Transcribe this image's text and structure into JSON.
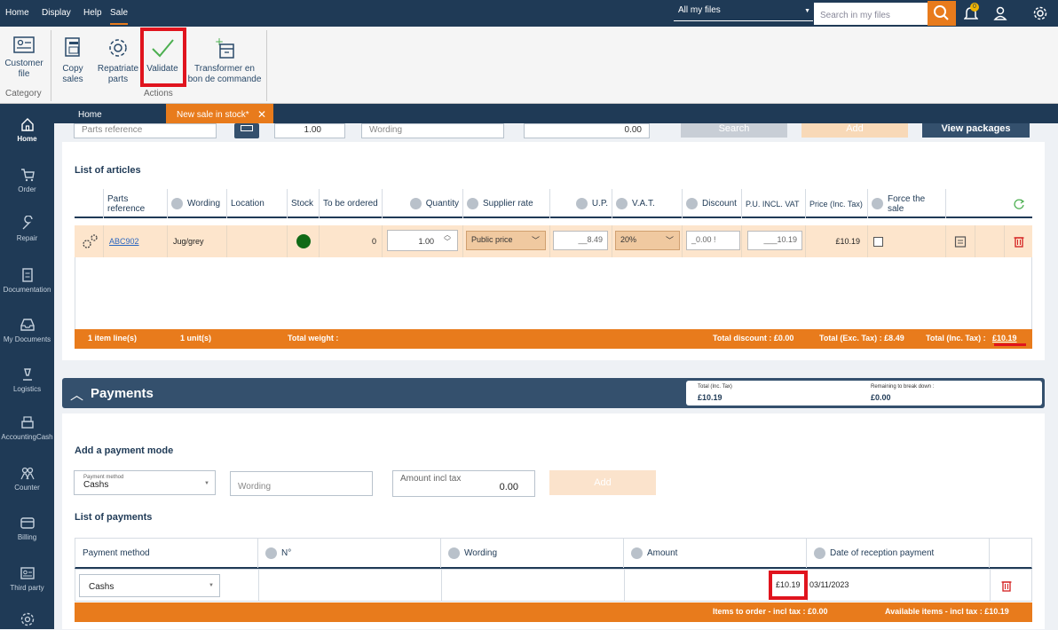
{
  "menu": {
    "home": "Home",
    "display": "Display",
    "help": "Help",
    "sale": "Sale"
  },
  "files_select": "All my files",
  "search": {
    "placeholder": "Search in my files",
    "notif_count": "0"
  },
  "ribbon": {
    "customer_file": "Customer file",
    "category": "Category",
    "copy_sales": "Copy sales",
    "repatriate_parts": "Repatriate parts",
    "validate": "Validate",
    "transform": "Transformer en bon de commande",
    "actions": "Actions"
  },
  "sidebar": [
    "Home",
    "Order",
    "Repair",
    "Documentation",
    "My Documents",
    "Logistics",
    "AccountingCash",
    "Counter",
    "Billing",
    "Third party"
  ],
  "tabs": {
    "home": "Home",
    "new_sale": "New sale in stock*"
  },
  "topform": {
    "parts_reference": "Parts reference",
    "qty": "1.00",
    "wording": "Wording",
    "amount": "0.00",
    "search_btn": "Search",
    "add_btn": "Add",
    "view_packages": "View packages"
  },
  "articles": {
    "title": "List of articles",
    "headers": [
      "Parts reference",
      "Wording",
      "Location",
      "Stock",
      "To be ordered",
      "Quantity",
      "Supplier rate",
      "U.P.",
      "V.A.T.",
      "Discount",
      "P.U. INCL. VAT",
      "Price (Inc. Tax)",
      "Force the sale"
    ],
    "row": {
      "ref": "ABC902",
      "wording": "Jug/grey",
      "location": "",
      "to_order": "0",
      "quantity": "1.00",
      "supplier_rate": "Public price",
      "up": "__8.49",
      "vat": "20%",
      "discount": "_0.00 !",
      "pu_incl": "___10.19",
      "price": "£10.19"
    },
    "footer": {
      "lines": "1  item line(s)",
      "units": "1  unit(s)",
      "weight": "Total weight :",
      "discount": "Total discount : £0.00",
      "excl": "Total (Exc. Tax) : £8.49",
      "incl_label": "Total (Inc. Tax) :",
      "incl_value": "£10.19"
    }
  },
  "payments": {
    "title": "Payments",
    "total_label": "Total (Inc. Tax)",
    "total_value": "£10.19",
    "remaining_label": "Remaining to break down :",
    "remaining_value": "£0.00",
    "add_title": "Add a payment mode",
    "method_label": "Payment method",
    "method_value": "Cashs",
    "wording_placeholder": "Wording",
    "amount_label": "Amount incl tax",
    "amount_value": "0.00",
    "add_btn": "Add",
    "list_title": "List of payments",
    "headers": [
      "Payment method",
      "N°",
      "Wording",
      "Amount",
      "Date of reception payment"
    ],
    "row": {
      "method": "Cashs",
      "amount": "£10.19",
      "date": "03/11/2023"
    },
    "footer": {
      "items_to_order": "Items to order - incl tax : £0.00",
      "available": "Available items - incl tax : £10.19"
    }
  },
  "colors": {
    "navy": "#1f3a56",
    "orange": "#e87b1c",
    "highlight": "#e0141e"
  }
}
